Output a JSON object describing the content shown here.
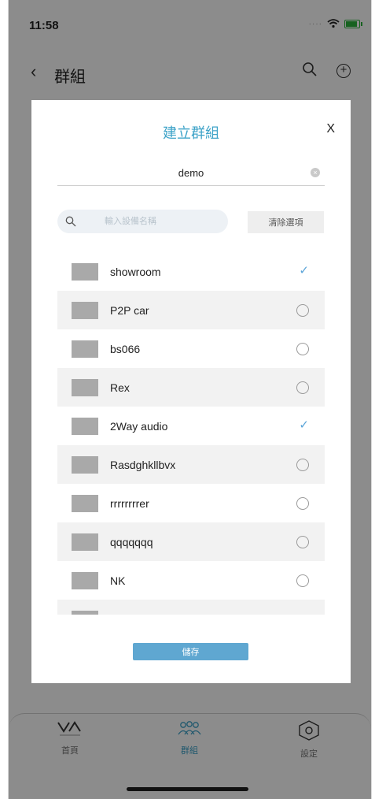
{
  "status": {
    "time": "11:58"
  },
  "header": {
    "title": "群組"
  },
  "modal": {
    "title": "建立群組",
    "close_label": "X",
    "group_name_value": "demo",
    "search_placeholder": "輸入設備名稱",
    "clear_selection_label": "清除選項",
    "save_label": "儲存",
    "devices": [
      {
        "name": "showroom",
        "selected": true
      },
      {
        "name": "P2P car",
        "selected": false
      },
      {
        "name": "bs066",
        "selected": false
      },
      {
        "name": "Rex",
        "selected": false
      },
      {
        "name": "2Way audio",
        "selected": true
      },
      {
        "name": "Rasdghkllbvx",
        "selected": false
      },
      {
        "name": "rrrrrrrrer",
        "selected": false
      },
      {
        "name": "qqqqqqq",
        "selected": false
      },
      {
        "name": "NK",
        "selected": false
      },
      {
        "name": "",
        "selected": false
      }
    ]
  },
  "tabs": [
    {
      "label": "首頁",
      "icon": "vacron-logo-icon",
      "active": false
    },
    {
      "label": "群組",
      "icon": "group-users-icon",
      "active": true
    },
    {
      "label": "設定",
      "icon": "settings-hexagon-icon",
      "active": false
    }
  ],
  "colors": {
    "accent": "#3ea3c8",
    "check": "#5aa4d8",
    "save_button": "#5fa7d1"
  }
}
